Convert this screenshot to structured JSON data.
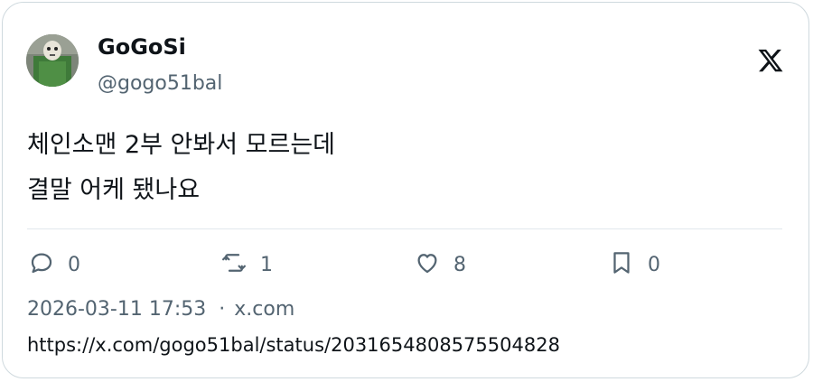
{
  "author": {
    "display_name": "GoGoSi",
    "handle": "@gogo51bal"
  },
  "brand_icon": "x-logo-icon",
  "tweet": {
    "text": "체인소맨 2부 안봐서 모르는데\n결말 어케 됐나요"
  },
  "actions": {
    "reply": {
      "icon": "reply-icon",
      "count": "0"
    },
    "retweet": {
      "icon": "retweet-icon",
      "count": "1"
    },
    "like": {
      "icon": "heart-icon",
      "count": "8"
    },
    "bookmark": {
      "icon": "bookmark-icon",
      "count": "0"
    }
  },
  "meta": {
    "timestamp": "2026-03-11 17:53",
    "separator": "·",
    "source": "x.com"
  },
  "status_url": "https://x.com/gogo51bal/status/2031654808575504828",
  "colors": {
    "text": "#0f1419",
    "secondary": "#536471",
    "border": "#cfd9de"
  }
}
